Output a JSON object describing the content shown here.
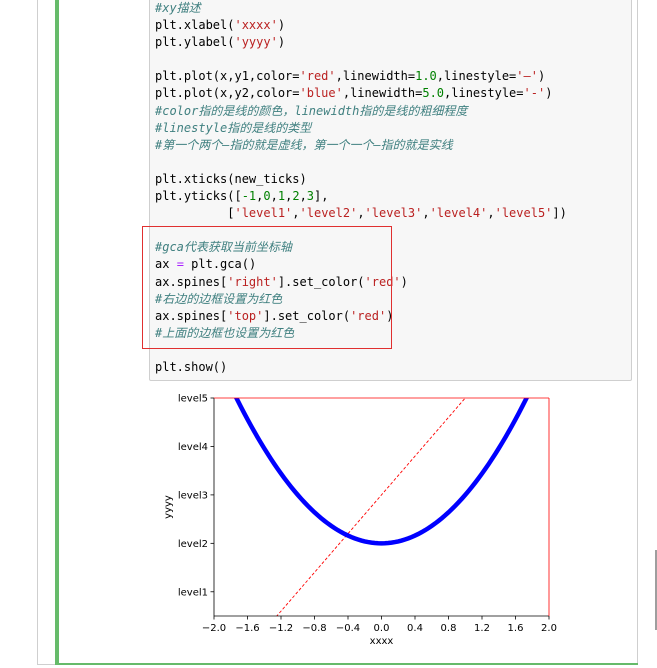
{
  "code_lines": [
    {
      "segs": [
        {
          "t": "#xy描述",
          "c": "cm"
        }
      ]
    },
    {
      "segs": [
        {
          "t": "plt.xlabel(",
          "c": ""
        },
        {
          "t": "'xxxx'",
          "c": "st"
        },
        {
          "t": ")",
          "c": ""
        }
      ]
    },
    {
      "segs": [
        {
          "t": "plt.ylabel(",
          "c": ""
        },
        {
          "t": "'yyyy'",
          "c": "st"
        },
        {
          "t": ")",
          "c": ""
        }
      ]
    },
    {
      "segs": [
        {
          "t": "",
          "c": ""
        }
      ]
    },
    {
      "segs": [
        {
          "t": "plt.plot(x,y1,color=",
          "c": ""
        },
        {
          "t": "'red'",
          "c": "st"
        },
        {
          "t": ",linewidth=",
          "c": ""
        },
        {
          "t": "1.0",
          "c": "nu"
        },
        {
          "t": ",linestyle=",
          "c": ""
        },
        {
          "t": "'—'",
          "c": "st"
        },
        {
          "t": ")",
          "c": ""
        }
      ]
    },
    {
      "segs": [
        {
          "t": "plt.plot(x,y2,color=",
          "c": ""
        },
        {
          "t": "'blue'",
          "c": "st"
        },
        {
          "t": ",linewidth=",
          "c": ""
        },
        {
          "t": "5.0",
          "c": "nu"
        },
        {
          "t": ",linestyle=",
          "c": ""
        },
        {
          "t": "'-'",
          "c": "st"
        },
        {
          "t": ")",
          "c": ""
        }
      ]
    },
    {
      "segs": [
        {
          "t": "#color指的是线的颜色，linewidth指的是线的粗细程度",
          "c": "cm"
        }
      ]
    },
    {
      "segs": [
        {
          "t": "#linestyle指的是线的类型",
          "c": "cm"
        }
      ]
    },
    {
      "segs": [
        {
          "t": "#第一个两个—指的就是虚线，第一个一个—指的就是实线",
          "c": "cm"
        }
      ]
    },
    {
      "segs": [
        {
          "t": "",
          "c": ""
        }
      ]
    },
    {
      "segs": [
        {
          "t": "plt.xticks(new_ticks)",
          "c": ""
        }
      ]
    },
    {
      "segs": [
        {
          "t": "plt.yticks([",
          "c": ""
        },
        {
          "t": "-1",
          "c": "nu"
        },
        {
          "t": ",",
          "c": ""
        },
        {
          "t": "0",
          "c": "nu"
        },
        {
          "t": ",",
          "c": ""
        },
        {
          "t": "1",
          "c": "nu"
        },
        {
          "t": ",",
          "c": ""
        },
        {
          "t": "2",
          "c": "nu"
        },
        {
          "t": ",",
          "c": ""
        },
        {
          "t": "3",
          "c": "nu"
        },
        {
          "t": "],",
          "c": ""
        }
      ]
    },
    {
      "segs": [
        {
          "t": "          [",
          "c": ""
        },
        {
          "t": "'level1'",
          "c": "st"
        },
        {
          "t": ",",
          "c": ""
        },
        {
          "t": "'level2'",
          "c": "st"
        },
        {
          "t": ",",
          "c": ""
        },
        {
          "t": "'level3'",
          "c": "st"
        },
        {
          "t": ",",
          "c": ""
        },
        {
          "t": "'level4'",
          "c": "st"
        },
        {
          "t": ",",
          "c": ""
        },
        {
          "t": "'level5'",
          "c": "st"
        },
        {
          "t": "])",
          "c": ""
        }
      ]
    },
    {
      "segs": [
        {
          "t": "",
          "c": ""
        }
      ]
    },
    {
      "segs": [
        {
          "t": "#gca代表获取当前坐标轴",
          "c": "cm"
        }
      ]
    },
    {
      "segs": [
        {
          "t": "ax ",
          "c": ""
        },
        {
          "t": "=",
          "c": "op"
        },
        {
          "t": " plt.gca()",
          "c": ""
        }
      ]
    },
    {
      "segs": [
        {
          "t": "ax.spines[",
          "c": ""
        },
        {
          "t": "'right'",
          "c": "st"
        },
        {
          "t": "].set_color(",
          "c": ""
        },
        {
          "t": "'red'",
          "c": "st"
        },
        {
          "t": ")",
          "c": ""
        }
      ]
    },
    {
      "segs": [
        {
          "t": "#右边的边框设置为红色",
          "c": "cm"
        }
      ]
    },
    {
      "segs": [
        {
          "t": "ax.spines[",
          "c": ""
        },
        {
          "t": "'top'",
          "c": "st"
        },
        {
          "t": "].set_color(",
          "c": ""
        },
        {
          "t": "'red'",
          "c": "st"
        },
        {
          "t": ")",
          "c": ""
        }
      ]
    },
    {
      "segs": [
        {
          "t": "#上面的边框也设置为红色",
          "c": "cm"
        }
      ]
    },
    {
      "segs": [
        {
          "t": "",
          "c": ""
        }
      ]
    },
    {
      "segs": [
        {
          "t": "plt.show()",
          "c": ""
        }
      ]
    }
  ],
  "colors": {
    "cell_accent": "#66bb6a",
    "highlight_box": "#e03030",
    "spine_red": "#ff0000",
    "y2_line": "#0000ff",
    "y1_line": "#ff0000"
  },
  "chart_data": {
    "type": "line",
    "xlabel": "xxxx",
    "ylabel": "yyyy",
    "xlim": [
      -2.0,
      2.0
    ],
    "ylim": [
      -1.5,
      3
    ],
    "xticks": [
      -2.0,
      -1.6,
      -1.2,
      -0.8,
      -0.4,
      0.0,
      0.4,
      0.8,
      1.2,
      1.6,
      2.0
    ],
    "xtick_labels": [
      "−2.0",
      "−1.6",
      "−1.2",
      "−0.8",
      "−0.4",
      "0.0",
      "0.4",
      "0.8",
      "1.2",
      "1.6",
      "2.0"
    ],
    "yticks": [
      -1,
      0,
      1,
      2,
      3
    ],
    "ytick_labels": [
      "level1",
      "level2",
      "level3",
      "level4",
      "level5"
    ],
    "series": [
      {
        "formula": "2*x+1",
        "color": "#ff0000",
        "linewidth": 1.0,
        "linestyle": "dashed",
        "x": [
          -2,
          -1,
          0,
          1,
          2
        ],
        "values": [
          -3,
          -1,
          1,
          3,
          5
        ]
      },
      {
        "formula": "x**2",
        "color": "#0000ff",
        "linewidth": 5.0,
        "linestyle": "solid",
        "x": [
          -2,
          -1.5,
          -1,
          -0.5,
          0,
          0.5,
          1,
          1.5,
          2
        ],
        "values": [
          4,
          2.25,
          1,
          0.25,
          0,
          0.25,
          1,
          2.25,
          4
        ]
      }
    ],
    "spines": {
      "top": "red",
      "right": "red"
    }
  }
}
